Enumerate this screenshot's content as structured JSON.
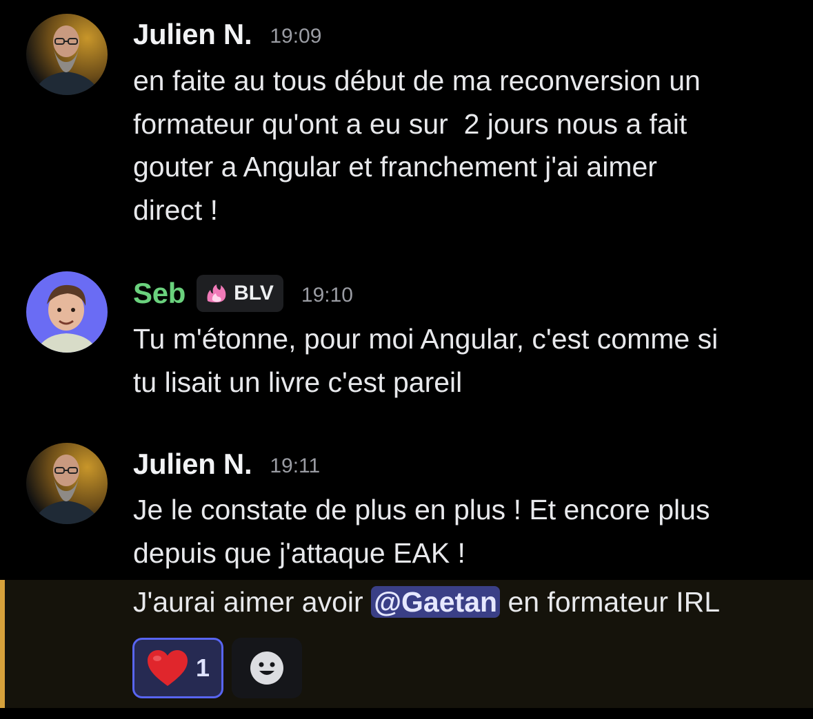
{
  "messages": [
    {
      "author": "Julien N.",
      "author_color": "#f2f3f5",
      "time": "19:09",
      "lines": [
        "en faite au tous début de ma reconversion un",
        "formateur qu'ont a eu sur  2 jours nous a fait",
        "gouter a Angular et franchement j'ai aimer",
        "direct !"
      ]
    },
    {
      "author": "Seb",
      "author_color": "#6ad17d",
      "role_badge": "BLV",
      "role_icon": "pink-flame-icon",
      "time": "19:10",
      "lines": [
        "Tu m'étonne, pour moi Angular, c'est comme si",
        "tu lisait un livre c'est pareil"
      ]
    },
    {
      "author": "Julien N.",
      "author_color": "#f2f3f5",
      "time": "19:11",
      "lines": [
        "Je le constate de plus en plus ! Et encore plus",
        "depuis que j'attaque EAK !"
      ],
      "followup": {
        "before": "J'aurai aimer avoir ",
        "mention": "@Gaetan",
        "after": " en formateur IRL"
      },
      "reactions": [
        {
          "emoji": "❤️",
          "icon": "red-heart-icon",
          "count": "1"
        }
      ],
      "add_reaction_icon": "smiley-add-reaction-icon"
    }
  ],
  "colors": {
    "mention_bg": "#3a3f86",
    "highlight_bg": "#15130b",
    "highlight_bar": "#d6a13b",
    "reaction_border": "#5865f2"
  }
}
